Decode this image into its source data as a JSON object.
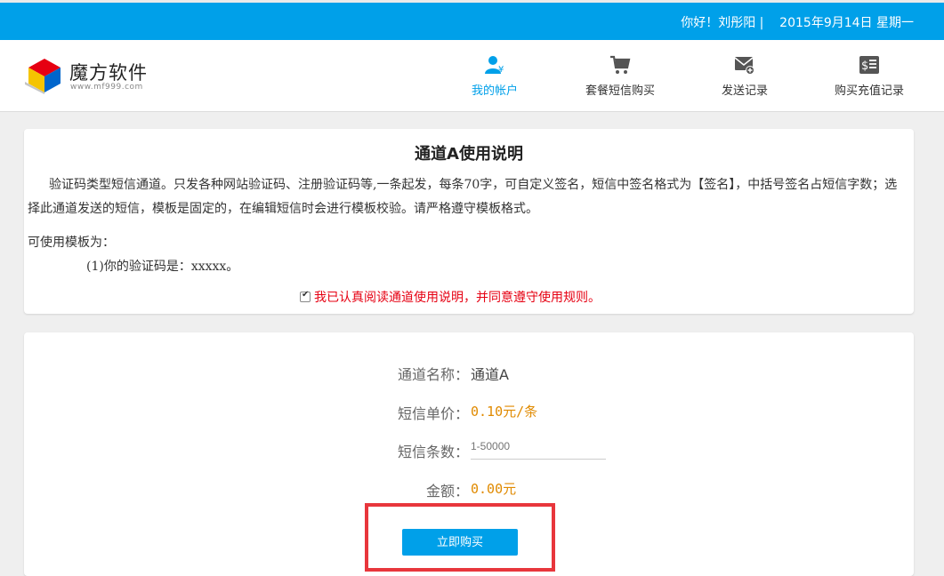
{
  "topbar": {
    "greeting": "你好！刘彤阳 |    2015年9月14日 星期一"
  },
  "logo": {
    "name": "魔方软件",
    "url": "www.mf999.com"
  },
  "nav": [
    {
      "label": "我的帐户",
      "icon": "user-yen-icon",
      "active": true
    },
    {
      "label": "套餐短信购买",
      "icon": "cart-icon",
      "active": false
    },
    {
      "label": "发送记录",
      "icon": "mail-add-icon",
      "active": false
    },
    {
      "label": "购买充值记录",
      "icon": "bill-icon",
      "active": false
    }
  ],
  "notice": {
    "title": "通道A使用说明",
    "paragraph": "验证码类型短信通道。只发各种网站验证码、注册验证码等,一条起发，每条70字，可自定义签名，短信中签名格式为【签名】，中括号签名占短信字数；选择此通道发送的短信，模板是固定的，在编辑短信时会进行模板校验。请严格遵守模板格式。",
    "template_label": "可使用模板为：",
    "template_item": "(1)你的验证码是：xxxxx。",
    "agree_text": "我已认真阅读通道使用说明，并同意遵守使用规则。",
    "agree_checked": true
  },
  "order": {
    "channel_label": "通道名称：",
    "channel_value": "通道A",
    "price_label": "短信单价：",
    "price_value": "0.10元/条",
    "count_label": "短信条数：",
    "count_placeholder": "1-50000",
    "amount_label": "金额：",
    "amount_value": "0.00元",
    "buy_label": "立即购买"
  },
  "colors": {
    "accent": "#00a0e9",
    "warning": "#e60012",
    "price": "#e08a00",
    "highlight": "#e8363c"
  }
}
